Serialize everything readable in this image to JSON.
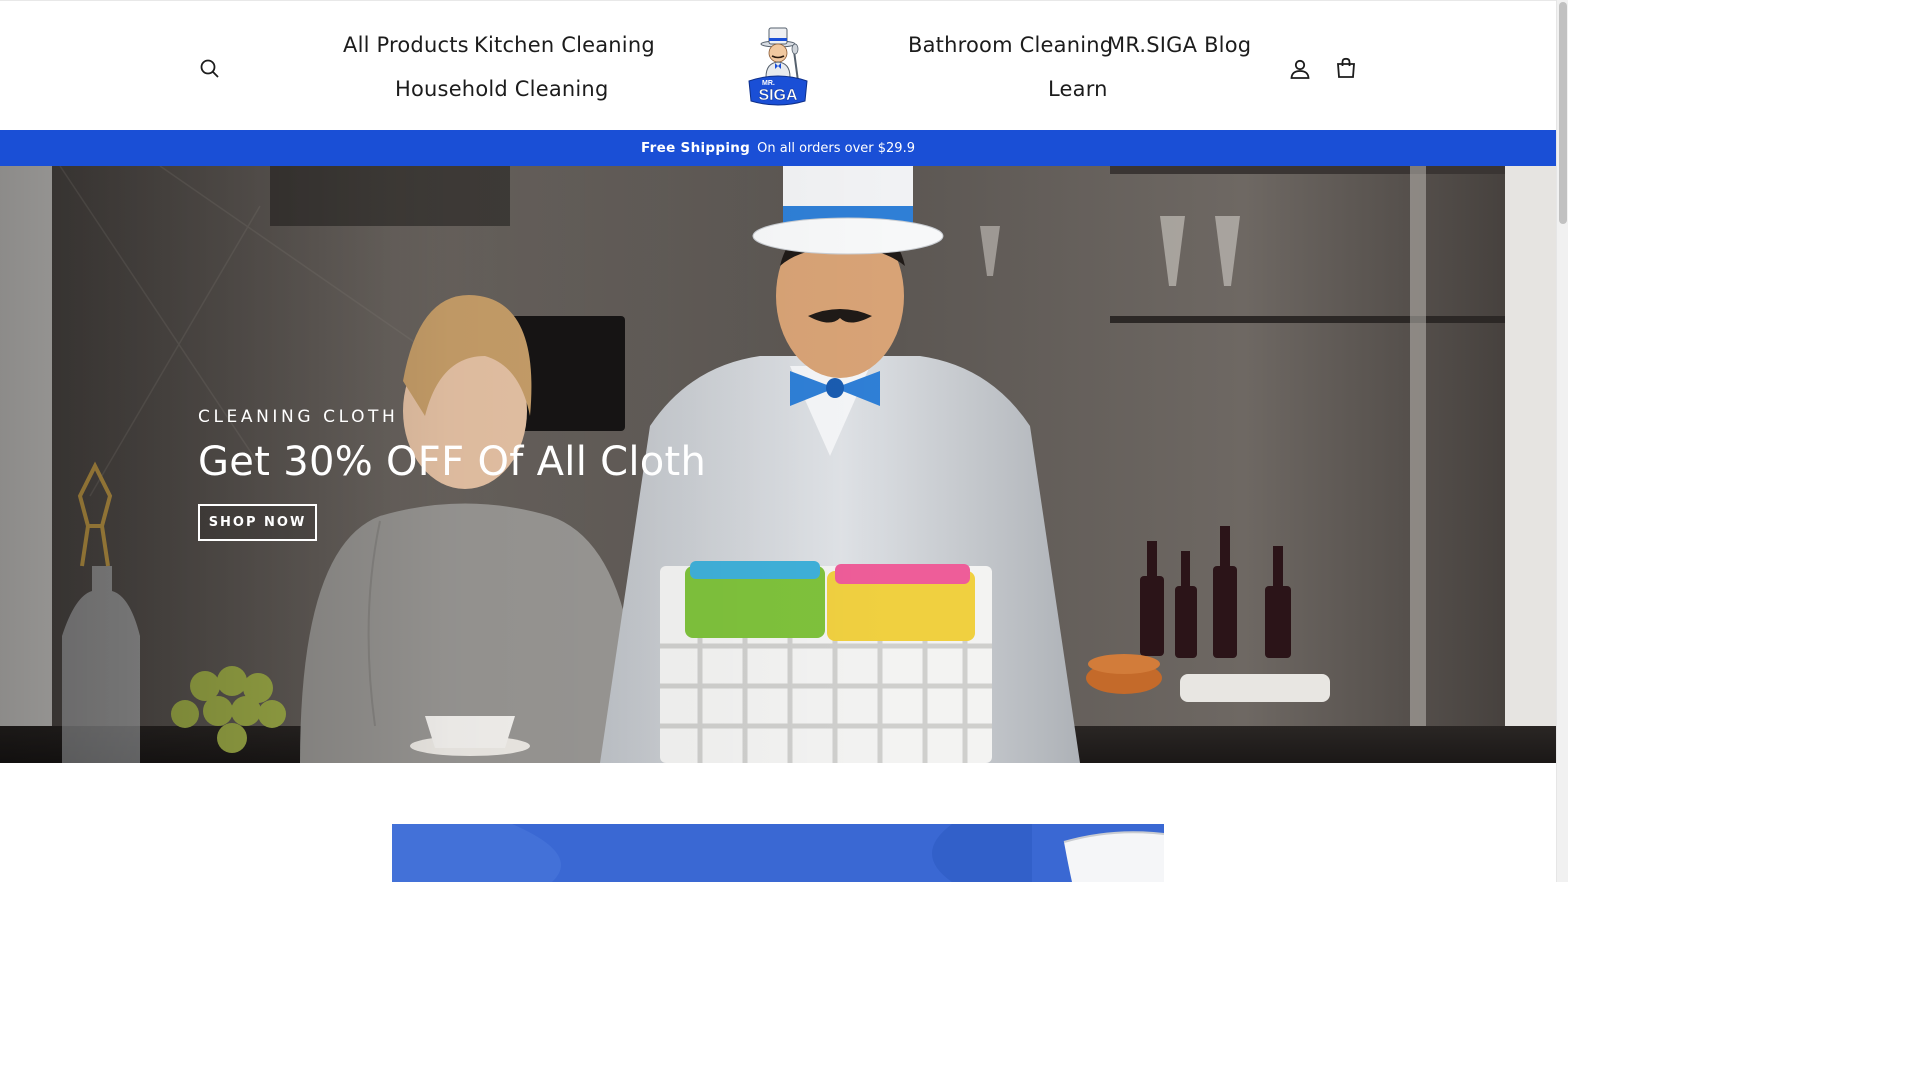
{
  "colors": {
    "brand_blue": "#1a4fd6",
    "text_dark": "#1c1c1c",
    "white": "#ffffff"
  },
  "header": {
    "nav_left": [
      {
        "label": "All Products"
      },
      {
        "label": "Kitchen Cleaning"
      },
      {
        "label": "Household Cleaning"
      }
    ],
    "nav_right": [
      {
        "label": "Bathroom Cleaning"
      },
      {
        "label": "MR.SIGA Blog"
      },
      {
        "label": "Learn"
      }
    ],
    "logo_text": "MR. SIGA",
    "icons": {
      "search": "search-icon",
      "account": "user-icon",
      "cart": "cart-icon"
    }
  },
  "announcement": {
    "strong": "Free Shipping",
    "text": "On all orders over $29.9"
  },
  "hero": {
    "subtitle": "CLEANING CLOTH",
    "title": "Get 30% OFF Of All Cloth",
    "cta": "SHOP NOW"
  }
}
